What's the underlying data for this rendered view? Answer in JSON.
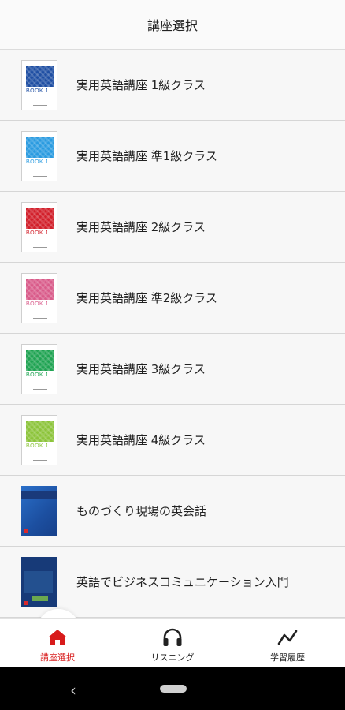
{
  "header": {
    "title": "講座選択"
  },
  "courses": [
    {
      "title": "実用英語講座 1級クラス",
      "cover": "book",
      "book_label": "BOOK 1",
      "color": "#1f4fa3",
      "label_color": "#1f4fa3"
    },
    {
      "title": "実用英語講座 準1級クラス",
      "cover": "book",
      "book_label": "BOOK 1",
      "color": "#2a9be0",
      "label_color": "#2a9be0"
    },
    {
      "title": "実用英語講座 2級クラス",
      "cover": "book",
      "book_label": "BOOK 1",
      "color": "#d21f2a",
      "label_color": "#d21f2a"
    },
    {
      "title": "実用英語講座 準2級クラス",
      "cover": "book",
      "book_label": "BOOK 1",
      "color": "#d95b8a",
      "label_color": "#d95b8a"
    },
    {
      "title": "実用英語講座 3級クラス",
      "cover": "book",
      "book_label": "BOOK 1",
      "color": "#1fa352",
      "label_color": "#1fa352"
    },
    {
      "title": "実用英語講座 4級クラス",
      "cover": "book",
      "book_label": "BOOK 1",
      "color": "#8cc43a",
      "label_color": "#8cc43a"
    },
    {
      "title": "ものづくり現場の英会話",
      "cover": "photo-blue"
    },
    {
      "title": "英語でビジネスコミュニケーション入門",
      "cover": "photo-navy"
    }
  ],
  "nav": {
    "items": [
      {
        "label": "講座選択",
        "icon": "home-icon",
        "active": true
      },
      {
        "label": "リスニング",
        "icon": "headphones-icon",
        "active": false
      },
      {
        "label": "学習履歴",
        "icon": "history-chart-icon",
        "active": false
      }
    ],
    "active_color": "#d81b1b",
    "inactive_color": "#222222"
  },
  "system": {
    "back_glyph": "‹"
  }
}
